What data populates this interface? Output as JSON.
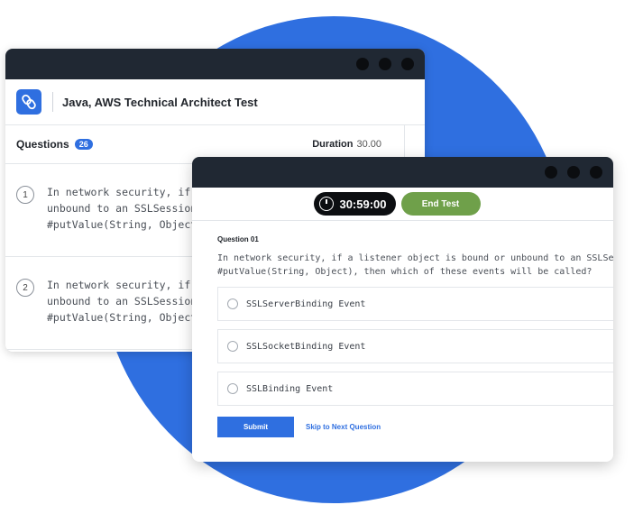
{
  "back_window": {
    "test_title": "Java, AWS Technical Architect Test",
    "questions_label": "Questions",
    "questions_count": "26",
    "duration_label": "Duration",
    "duration_value": "30.00",
    "items": [
      {
        "number": "1",
        "lines": [
          "In network security, if a liste",
          "unbound to an SSLSession b",
          "#putValue(String, Object), th"
        ]
      },
      {
        "number": "2",
        "lines": [
          "In network security, if a liste",
          "unbound to an SSLSession b",
          "#putValue(String, Object), th"
        ]
      }
    ]
  },
  "front_window": {
    "timer": "30:59:00",
    "end_test_label": "End Test",
    "question_number": "Question 01",
    "question_lines": [
      "In network security, if a listener object is bound or unbound to an SSLSession by SSLS",
      "#putValue(String, Object), then which of these events will be called?"
    ],
    "options": [
      "SSLServerBinding Event",
      "SSLSocketBinding Event",
      "SSLBinding Event"
    ],
    "submit_label": "Submit",
    "skip_label": "Skip to Next Question"
  },
  "colors": {
    "accent": "#2f6fe0",
    "titlebar": "#202833",
    "end_test": "#6fa04a"
  }
}
